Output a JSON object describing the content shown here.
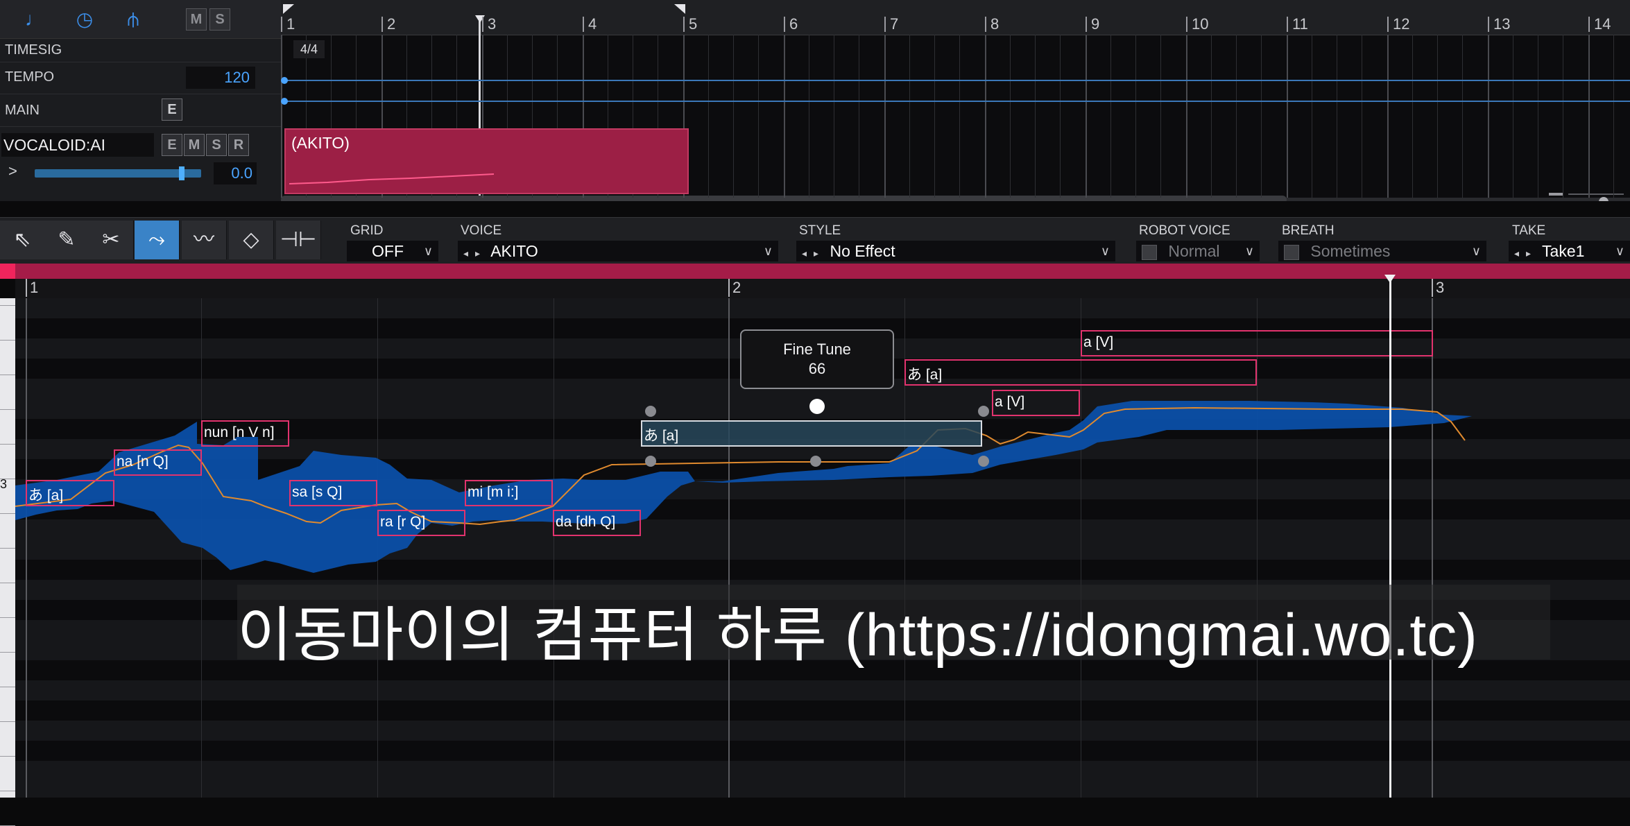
{
  "header": {
    "icons": [
      "note-icon",
      "clock-icon",
      "tuning-fork-icon"
    ],
    "mute_label": "M",
    "solo_label": "S"
  },
  "tracks": {
    "timesig_label": "TIMESIG",
    "tempo_label": "TEMPO",
    "tempo_value": "120",
    "main_label": "MAIN",
    "main_e": "E",
    "vocal_name": "VOCALOID:AI",
    "vocal_buttons": [
      "E",
      "M",
      "S",
      "R"
    ],
    "expand": ">",
    "volume_value": "0.0",
    "volume_level": 0.9
  },
  "timeline": {
    "bars": [
      "1",
      "2",
      "3",
      "4",
      "5",
      "6",
      "7",
      "8",
      "9",
      "10",
      "11",
      "12",
      "13",
      "14"
    ],
    "time_signature": "4/4",
    "part_label": "(AKITO)"
  },
  "toolbar": {
    "grid_label": "GRID",
    "grid_value": "OFF",
    "voice_label": "VOICE",
    "voice_value": "AKITO",
    "style_label": "STYLE",
    "style_value": "No Effect",
    "robot_label": "ROBOT VOICE",
    "robot_value": "Normal",
    "breath_label": "BREATH",
    "breath_value": "Sometimes",
    "take_label": "TAKE",
    "take_value": "Take1",
    "tools": [
      "arrow-tool-icon",
      "pencil-tool-icon",
      "scissors-tool-icon",
      "pitch-tool-icon",
      "vibrato-tool-icon",
      "dynamics-tool-icon",
      "range-tool-icon"
    ]
  },
  "roll": {
    "bars": [
      "1",
      "2",
      "3"
    ],
    "key_label": "3",
    "tooltip_title": "Fine Tune",
    "tooltip_value": "66",
    "notes": [
      "あ [a]",
      "na [n Q]",
      "nun [n V n]",
      "sa [s Q]",
      "ra [r Q]",
      "mi [m i:]",
      "da [dh Q]",
      "あ [a]",
      "あ [a]",
      "a [V]",
      "a [V]"
    ]
  },
  "watermark": "이동마이의 컴퓨터 하루 (https://idongmai.wo.tc)",
  "colors": {
    "accent": "#3a83c7",
    "part": "#9c1f45",
    "note_border": "#e2336e",
    "waveform": "#0b4fa8",
    "pitch_curve": "#e08a2e"
  }
}
